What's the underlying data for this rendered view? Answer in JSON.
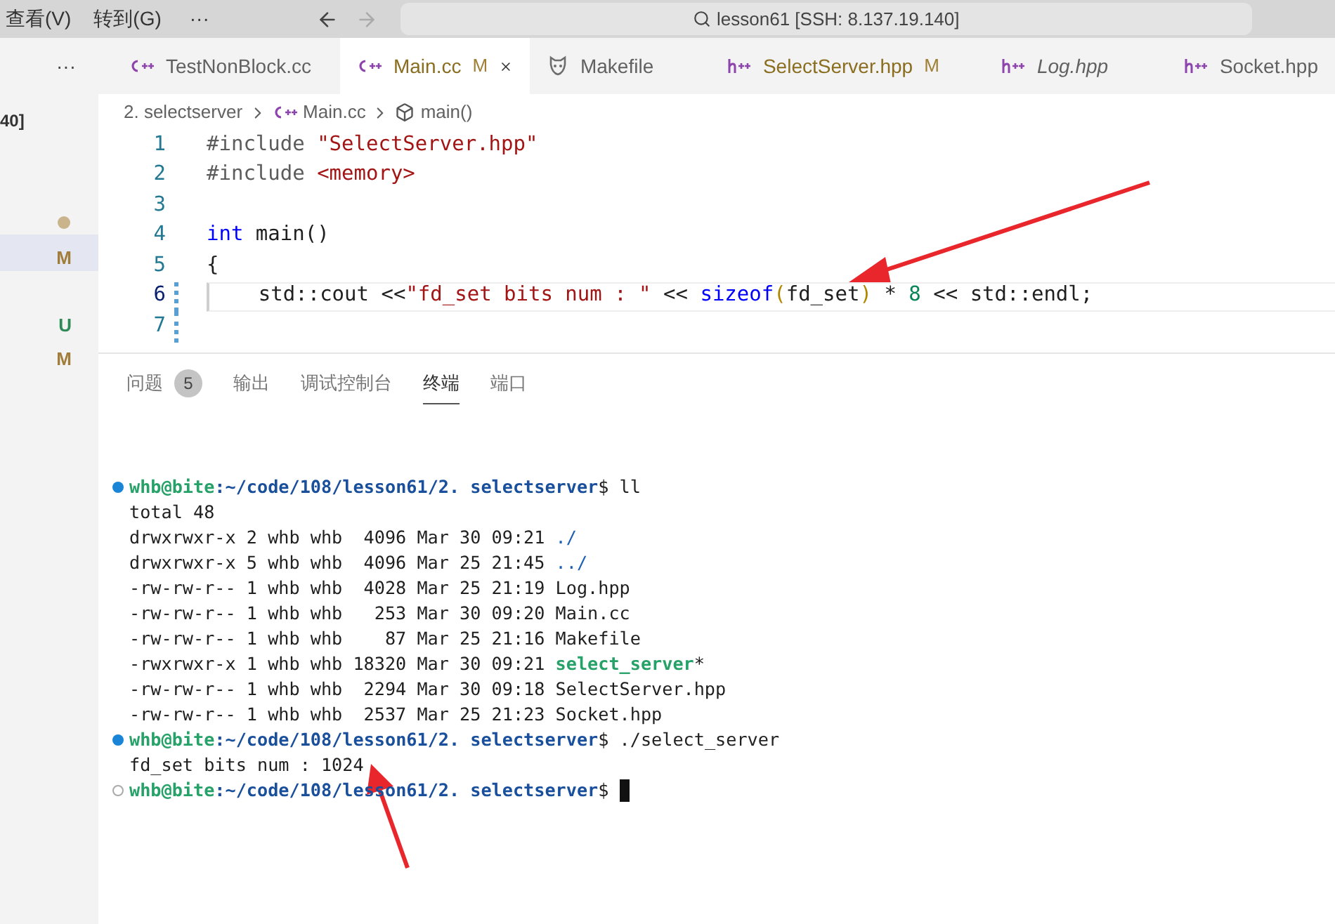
{
  "title_bar": {
    "menus": [
      "查看(V)",
      "转到(G)",
      "···"
    ],
    "title": "lesson61 [SSH: 8.137.19.140]"
  },
  "sidebar": {
    "overflow": "···",
    "items": [
      {
        "kind": "text",
        "text": "40]",
        "selected": false
      },
      {
        "kind": "dot",
        "color": "#c9b48c",
        "selected": false
      },
      {
        "kind": "letter",
        "text": "M",
        "color": "#a07d3a",
        "selected": true
      },
      {
        "kind": "letter",
        "text": "U",
        "color": "#2e8b57",
        "selected": false
      },
      {
        "kind": "letter",
        "text": "M",
        "color": "#a07d3a",
        "selected": false
      }
    ]
  },
  "tabs": [
    {
      "label": "TestNonBlock.cc",
      "kind": "cpp",
      "selected": false,
      "modified": false,
      "preview": false
    },
    {
      "label": "Main.cc",
      "kind": "cpp",
      "selected": true,
      "modified": true,
      "badge": "M",
      "preview": false
    },
    {
      "label": "Makefile",
      "kind": "make",
      "selected": false,
      "modified": false,
      "preview": false
    },
    {
      "label": "SelectServer.hpp",
      "kind": "hpp",
      "selected": false,
      "modified": true,
      "badge": "M",
      "preview": false
    },
    {
      "label": "Log.hpp",
      "kind": "hpp",
      "selected": false,
      "modified": false,
      "preview": true
    },
    {
      "label": "Socket.hpp",
      "kind": "hpp",
      "selected": false,
      "modified": false,
      "preview": false
    }
  ],
  "breadcrumb": [
    {
      "label": "2. selectserver",
      "kind": "folder"
    },
    {
      "label": "Main.cc",
      "kind": "cpp"
    },
    {
      "label": "main()",
      "kind": "symbol"
    }
  ],
  "code_lines": [
    {
      "number": "1",
      "current": false,
      "changed": false,
      "tokens": [
        {
          "text": "#include ",
          "kind": "pre"
        },
        {
          "text": "\"SelectServer.hpp\"",
          "kind": "str"
        }
      ]
    },
    {
      "number": "2",
      "current": false,
      "changed": false,
      "tokens": [
        {
          "text": "#include ",
          "kind": "pre"
        },
        {
          "text": "<memory>",
          "kind": "str"
        }
      ]
    },
    {
      "number": "3",
      "current": false,
      "changed": false
    },
    {
      "number": "4",
      "current": false,
      "changed": false,
      "tokens": [
        {
          "text": "int",
          "kind": "kw"
        },
        {
          "text": " main()",
          "kind": "plain"
        }
      ]
    },
    {
      "number": "5",
      "current": false,
      "changed": false,
      "tokens": [
        {
          "text": "{",
          "kind": "plain"
        }
      ]
    },
    {
      "number": "6",
      "current": true,
      "changed": true,
      "tokens": [
        {
          "text": "    std::cout <<",
          "kind": "plain"
        },
        {
          "text": "\"fd_set bits num : \"",
          "kind": "str"
        },
        {
          "text": " << ",
          "kind": "plain"
        },
        {
          "text": "sizeof",
          "kind": "kw"
        },
        {
          "text": "(",
          "kind": "bracket"
        },
        {
          "text": "fd_set",
          "kind": "plain"
        },
        {
          "text": ")",
          "kind": "bracket"
        },
        {
          "text": " * ",
          "kind": "plain"
        },
        {
          "text": "8",
          "kind": "num"
        },
        {
          "text": " << std::endl;",
          "kind": "plain"
        }
      ]
    },
    {
      "number": "7",
      "current": false,
      "changed": true
    }
  ],
  "panel": {
    "tabs": [
      {
        "label": "问题",
        "count": "5",
        "selected": false
      },
      {
        "label": "输出",
        "selected": false
      },
      {
        "label": "调试控制台",
        "selected": false
      },
      {
        "label": "终端",
        "selected": true
      },
      {
        "label": "端口",
        "selected": false
      }
    ],
    "terminal": [
      {
        "kind": "prompt",
        "finished": true,
        "user": "whb@bite",
        "path": ":~/code/108/lesson61/2. selectserver",
        "command": "$ ll",
        "cursor": false
      },
      {
        "kind": "output",
        "tokens": [
          {
            "text": "total 48",
            "kind": "plain"
          }
        ]
      },
      {
        "kind": "output",
        "tokens": [
          {
            "text": "drwxrwxr-x 2 whb whb  4096 Mar 30 09:21 ",
            "kind": "plain"
          },
          {
            "text": "./",
            "kind": "dir"
          }
        ]
      },
      {
        "kind": "output",
        "tokens": [
          {
            "text": "drwxrwxr-x 5 whb whb  4096 Mar 25 21:45 ",
            "kind": "plain"
          },
          {
            "text": "../",
            "kind": "dir"
          }
        ]
      },
      {
        "kind": "output",
        "tokens": [
          {
            "text": "-rw-rw-r-- 1 whb whb  4028 Mar 25 21:19 Log.hpp",
            "kind": "plain"
          }
        ]
      },
      {
        "kind": "output",
        "tokens": [
          {
            "text": "-rw-rw-r-- 1 whb whb   253 Mar 30 09:20 Main.cc",
            "kind": "plain"
          }
        ]
      },
      {
        "kind": "output",
        "tokens": [
          {
            "text": "-rw-rw-r-- 1 whb whb    87 Mar 25 21:16 Makefile",
            "kind": "plain"
          }
        ]
      },
      {
        "kind": "output",
        "tokens": [
          {
            "text": "-rwxrwxr-x 1 whb whb 18320 Mar 30 09:21 ",
            "kind": "plain"
          },
          {
            "text": "select_server",
            "kind": "exec"
          },
          {
            "text": "*",
            "kind": "plain"
          }
        ]
      },
      {
        "kind": "output",
        "tokens": [
          {
            "text": "-rw-rw-r-- 1 whb whb  2294 Mar 30 09:18 SelectServer.hpp",
            "kind": "plain"
          }
        ]
      },
      {
        "kind": "output",
        "tokens": [
          {
            "text": "-rw-rw-r-- 1 whb whb  2537 Mar 25 21:23 Socket.hpp",
            "kind": "plain"
          }
        ]
      },
      {
        "kind": "prompt",
        "finished": true,
        "user": "whb@bite",
        "path": ":~/code/108/lesson61/2. selectserver",
        "command": "$ ./select_server",
        "cursor": false
      },
      {
        "kind": "output",
        "tokens": [
          {
            "text": "fd_set bits num : 1024",
            "kind": "plain"
          }
        ]
      },
      {
        "kind": "prompt",
        "finished": false,
        "user": "whb@bite",
        "path": ":~/code/108/lesson61/2. selectserver",
        "command": "$ ",
        "cursor": true
      }
    ]
  }
}
